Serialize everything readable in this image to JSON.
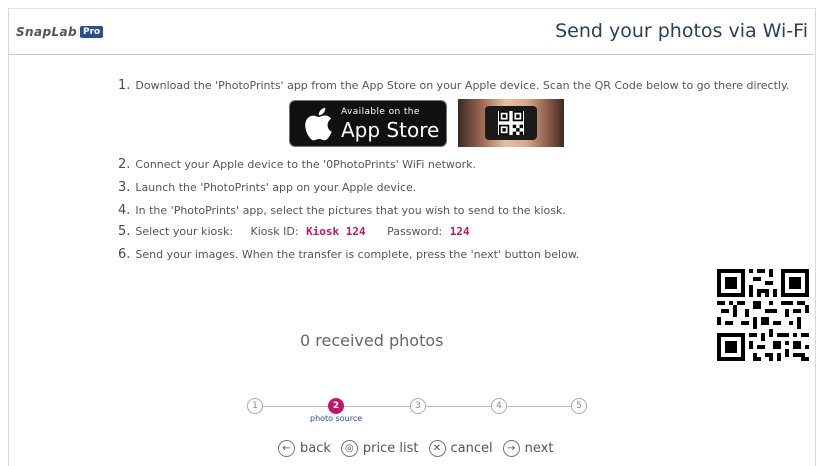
{
  "header": {
    "logo_text": "SnapLab",
    "logo_badge": "Pro",
    "title": "Send your photos via Wi-Fi"
  },
  "steps": [
    {
      "num": "1.",
      "text": "Download the 'PhotoPrints' app from the App Store on your Apple device. Scan the QR Code below to go there directly."
    },
    {
      "num": "2.",
      "text": "Connect your Apple device to the '0PhotoPrints' WiFi network."
    },
    {
      "num": "3.",
      "text": "Launch the 'PhotoPrints' app on your Apple device."
    },
    {
      "num": "4.",
      "text": "In the 'PhotoPrints' app, select the pictures that you wish to send to the kiosk."
    },
    {
      "num": "5.",
      "text": "Select your kiosk:"
    },
    {
      "num": "6.",
      "text": "Send your images. When the transfer is complete, press the 'next' button below."
    }
  ],
  "kiosk": {
    "id_label": "Kiosk ID:",
    "id_value": "Kiosk 124",
    "password_label": "Password:",
    "password_value": "124"
  },
  "appstore": {
    "small": "Available on the",
    "big": "App Store"
  },
  "received": "0 received photos",
  "progress": {
    "steps": [
      "1",
      "2",
      "3",
      "4",
      "5"
    ],
    "current": 2,
    "current_label": "photo source"
  },
  "nav": {
    "back": "back",
    "price_list": "price list",
    "cancel": "cancel",
    "next": "next"
  },
  "colors": {
    "accent": "#c0166a",
    "brand": "#2c4e8c"
  }
}
